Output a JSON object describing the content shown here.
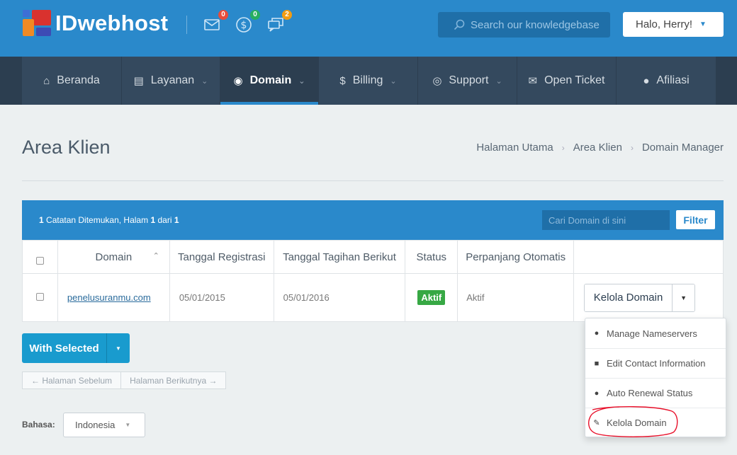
{
  "brand": {
    "name": "IDwebhost"
  },
  "header": {
    "icons": [
      {
        "name": "envelope-icon",
        "badge": "0",
        "badge_color": "#e74c3c"
      },
      {
        "name": "dollar-icon",
        "badge": "0",
        "badge_color": "#27ae60"
      },
      {
        "name": "chat-icon",
        "badge": "2",
        "badge_color": "#f39c12"
      }
    ],
    "search_placeholder": "Search our knowledgebase",
    "user_greeting": "Halo, Herry!"
  },
  "nav": {
    "items": [
      {
        "label": "Beranda",
        "icon": "home-icon"
      },
      {
        "label": "Layanan",
        "icon": "list-icon"
      },
      {
        "label": "Domain",
        "icon": "binoculars-icon"
      },
      {
        "label": "Billing",
        "icon": "dollar-icon"
      },
      {
        "label": "Support",
        "icon": "lifebuoy-icon"
      },
      {
        "label": "Open Ticket",
        "icon": "envelope-icon"
      },
      {
        "label": "Afiliasi",
        "icon": "user-icon"
      }
    ],
    "active": "Domain"
  },
  "page": {
    "title": "Area Klien",
    "breadcrumb": [
      "Halaman Utama",
      "Area Klien",
      "Domain Manager"
    ]
  },
  "table_panel": {
    "records_count": "1",
    "records_text_1": "Catatan Ditemukan, Halam",
    "page_current": "1",
    "records_text_2": "dari",
    "page_total": "1",
    "filter_placeholder": "Cari Domain di sini",
    "filter_button": "Filter"
  },
  "table": {
    "columns": [
      "Domain",
      "Tanggal Registrasi",
      "Tanggal Tagihan Berikut",
      "Status",
      "Perpanjang Otomatis"
    ],
    "rows": [
      {
        "domain": "penelusuranmu.com",
        "registration": "05/01/2015",
        "next_due": "05/01/2016",
        "status": "Aktif",
        "auto_renew": "Aktif",
        "action": "Kelola Domain"
      }
    ]
  },
  "bulk": {
    "with_selected": "With Selected"
  },
  "pager": {
    "prev": "← Halaman Sebelum",
    "next": "Halaman Berikutnya →"
  },
  "language": {
    "label": "Bahasa:",
    "selected": "Indonesia"
  },
  "dropdown": {
    "items": [
      {
        "label": "Manage Nameservers",
        "icon": "globe-icon"
      },
      {
        "label": "Edit Contact Information",
        "icon": "user-icon"
      },
      {
        "label": "Auto Renewal Status",
        "icon": "globe-icon"
      },
      {
        "label": "Kelola Domain",
        "icon": "pencil-icon"
      }
    ]
  },
  "colors": {
    "primary": "#2a89cb",
    "nav_bg": "#34495e",
    "success": "#37a844",
    "annotation": "#e8102a"
  }
}
